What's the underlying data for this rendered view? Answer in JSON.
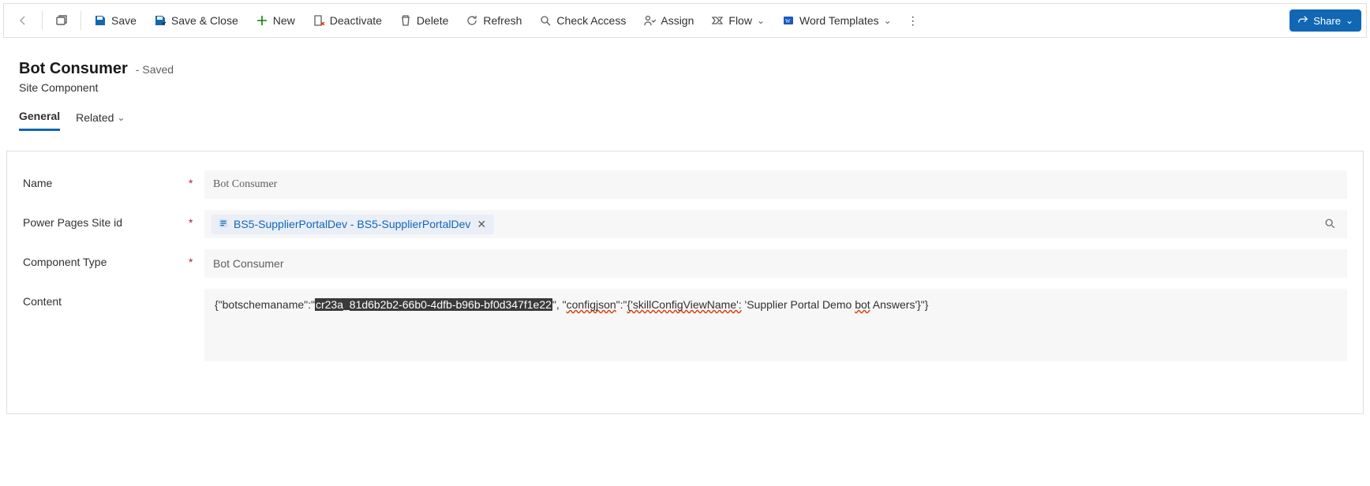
{
  "commandBar": {
    "save": "Save",
    "saveClose": "Save & Close",
    "new": "New",
    "deactivate": "Deactivate",
    "delete": "Delete",
    "refresh": "Refresh",
    "checkAccess": "Check Access",
    "assign": "Assign",
    "flow": "Flow",
    "wordTemplates": "Word Templates",
    "share": "Share"
  },
  "header": {
    "title": "Bot Consumer",
    "status": "Saved",
    "entity": "Site Component"
  },
  "tabs": {
    "general": "General",
    "related": "Related"
  },
  "fields": {
    "name": {
      "label": "Name",
      "value": "Bot Consumer"
    },
    "siteId": {
      "label": "Power Pages Site id",
      "chip": "BS5-SupplierPortalDev - BS5-SupplierPortalDev"
    },
    "componentType": {
      "label": "Component Type",
      "value": "Bot Consumer"
    },
    "content": {
      "label": "Content",
      "prefix": "{\"botschemaname\":\"",
      "highlighted": "cr23a_81d6b2b2-66b0-4dfb-b96b-bf0d347f1e22",
      "mid1": "\", \"",
      "squiggle1": "configjson",
      "mid2": "\":\"",
      "squiggle2": "{'skillConfigViewName':",
      "mid3": " 'Supplier Portal Demo ",
      "squiggle3": "bot",
      "suffix": " Answers'}\"}"
    }
  }
}
